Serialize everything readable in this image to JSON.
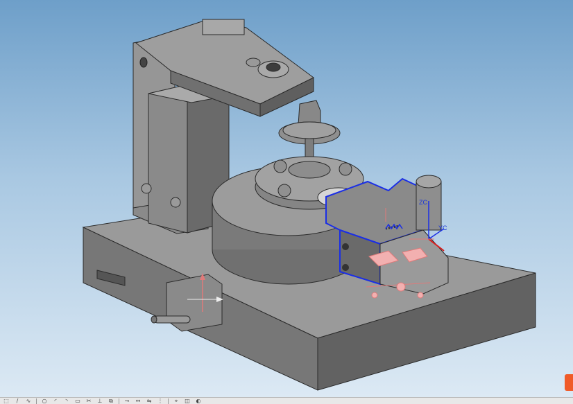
{
  "viewport": {
    "title": "3D model viewport",
    "background_colors": [
      "#6e9fc9",
      "#dce9f4"
    ]
  },
  "model": {
    "part_color": "#8c8c8c",
    "shadow_color": "#5e5e5e",
    "highlight_color": "#b5b5b5",
    "selection_color": "#1a2ee6"
  },
  "triad": {
    "axis_labels": [
      "ZC",
      "YC",
      "XC"
    ]
  },
  "toolbar": {
    "icons": [
      "select-icon",
      "line-icon",
      "curve-icon",
      "circle-icon",
      "arc-icon",
      "arc2-icon",
      "rectangle-icon",
      "trim-icon",
      "extend-icon",
      "offset-icon",
      "constraint-icon",
      "dimension-icon",
      "mirror-icon",
      "pattern-icon",
      "snap-icon",
      "view-icon",
      "render-icon"
    ]
  },
  "brand": {
    "color": "#f05a28"
  }
}
